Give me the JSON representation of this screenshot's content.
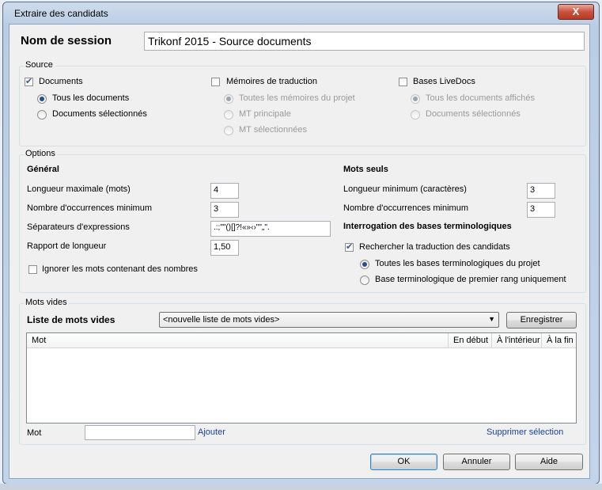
{
  "window": {
    "title": "Extraire des candidats",
    "close_label": "X"
  },
  "session": {
    "label": "Nom de session",
    "value": "Trikonf 2015 - Source documents"
  },
  "source": {
    "title": "Source",
    "documents": {
      "label": "Documents",
      "checked": true,
      "options": [
        {
          "label": "Tous les documents",
          "selected": true
        },
        {
          "label": "Documents sélectionnés",
          "selected": false
        }
      ]
    },
    "memoires": {
      "label": "Mémoires de traduction",
      "checked": false,
      "options": [
        {
          "label": "Toutes les mémoires du projet",
          "selected": true
        },
        {
          "label": "MT principale",
          "selected": false
        },
        {
          "label": "MT sélectionnées",
          "selected": false
        }
      ]
    },
    "livedocs": {
      "label": "Bases LiveDocs",
      "checked": false,
      "options": [
        {
          "label": "Tous les documents affichés",
          "selected": true
        },
        {
          "label": "Documents sélectionnés",
          "selected": false
        }
      ]
    }
  },
  "options": {
    "title": "Options",
    "general": {
      "heading": "Général",
      "max_length": {
        "label": "Longueur maximale (mots)",
        "value": "4"
      },
      "min_occurrences": {
        "label": "Nombre d'occurrences minimum",
        "value": "3"
      },
      "separators": {
        "label": "Séparateurs d'expressions",
        "value": ".:;\"\"()[]?!«»‹›\"\"„''."
      },
      "ratio": {
        "label": "Rapport de longueur",
        "value": "1,50"
      },
      "ignore_numbers": {
        "label": "Ignorer les mots contenant des nombres",
        "checked": false
      }
    },
    "single": {
      "heading": "Mots seuls",
      "min_length": {
        "label": "Longueur minimum (caractères)",
        "value": "3"
      },
      "min_occurrences": {
        "label": "Nombre d'occurrences minimum",
        "value": "3"
      }
    },
    "termbase": {
      "heading": "Interrogation des bases terminologiques",
      "lookup": {
        "label": "Rechercher la traduction des candidats",
        "checked": true
      },
      "options": [
        {
          "label": "Toutes les bases terminologiques du projet",
          "selected": true
        },
        {
          "label": "Base terminologique de premier rang uniquement",
          "selected": false
        }
      ]
    }
  },
  "stopwords": {
    "title": "Mots vides",
    "list_label": "Liste de mots vides",
    "list_value": "<nouvelle liste de mots vides>",
    "save_label": "Enregistrer",
    "columns": [
      "Mot",
      "En début",
      "À l'intérieur",
      "À la fin"
    ],
    "word_label": "Mot",
    "word_value": "",
    "add_label": "Ajouter",
    "delete_label": "Supprimer sélection"
  },
  "buttons": {
    "ok": "OK",
    "cancel": "Annuler",
    "help": "Aide"
  }
}
